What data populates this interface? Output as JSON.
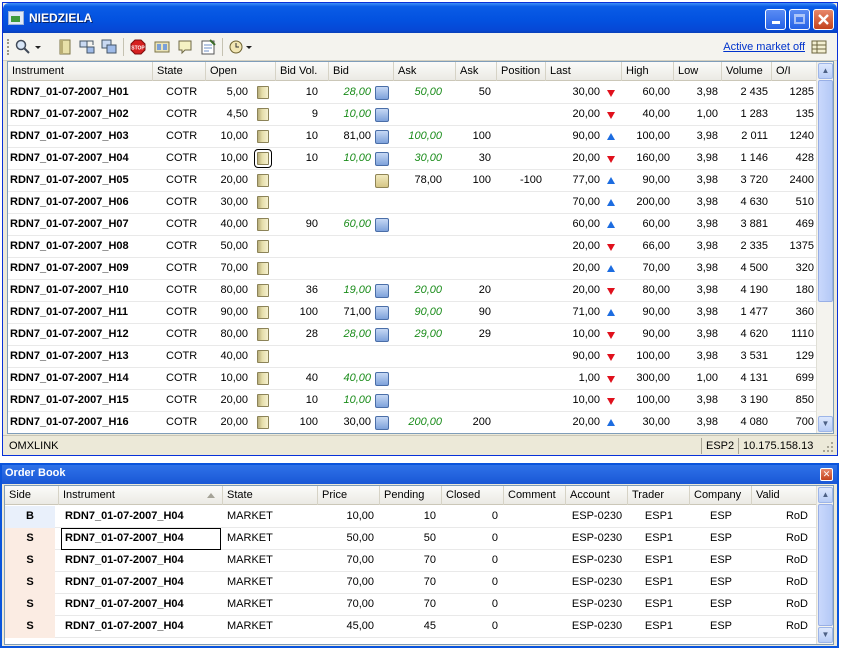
{
  "window": {
    "title": "NIEDZIELA",
    "active_market_link": "Active market off"
  },
  "columns": [
    "Instrument",
    "State",
    "Open",
    "Bid Vol.",
    "Bid",
    "Ask",
    "Ask",
    "Position",
    "Last",
    "High",
    "Low",
    "Volume",
    "O/I"
  ],
  "rows": [
    {
      "instrument": "RDN7_01-07-2007_H01",
      "state": "COTR",
      "open": "5,00",
      "bidvol": "10",
      "bid": "28,00",
      "bid_green": true,
      "bid_icon": "blue",
      "ask": "50,00",
      "askvol": "50",
      "position": "",
      "last": "30,00",
      "dir": "down",
      "high": "60,00",
      "low": "3,98",
      "volume": "2 435",
      "oi": "1285"
    },
    {
      "instrument": "RDN7_01-07-2007_H02",
      "state": "COTR",
      "open": "4,50",
      "bidvol": "9",
      "bid": "10,00",
      "bid_green": true,
      "bid_icon": "blue",
      "ask": "",
      "askvol": "",
      "position": "",
      "last": "20,00",
      "dir": "down",
      "high": "40,00",
      "low": "1,00",
      "volume": "1 283",
      "oi": "135"
    },
    {
      "instrument": "RDN7_01-07-2007_H03",
      "state": "COTR",
      "open": "10,00",
      "bidvol": "10",
      "bid": "81,00",
      "bid_green": false,
      "bid_icon": "blue",
      "ask": "100,00",
      "askvol": "100",
      "position": "",
      "last": "90,00",
      "dir": "up",
      "high": "100,00",
      "low": "3,98",
      "volume": "2 011",
      "oi": "1240"
    },
    {
      "instrument": "RDN7_01-07-2007_H04",
      "state": "COTR",
      "open": "10,00",
      "bidvol": "10",
      "bid": "10,00",
      "bid_green": true,
      "bid_icon": "blue",
      "ask": "30,00",
      "askvol": "30",
      "position": "",
      "last": "20,00",
      "dir": "down",
      "high": "160,00",
      "low": "3,98",
      "volume": "1 146",
      "oi": "428",
      "boxed": true
    },
    {
      "instrument": "RDN7_01-07-2007_H05",
      "state": "COTR",
      "open": "20,00",
      "bidvol": "",
      "bid": "",
      "bid_green": false,
      "bid_icon": "tan",
      "ask": "78,00",
      "ask_plain": true,
      "askvol": "100",
      "position": "-100",
      "last": "77,00",
      "dir": "up",
      "high": "90,00",
      "low": "3,98",
      "volume": "3 720",
      "oi": "2400"
    },
    {
      "instrument": "RDN7_01-07-2007_H06",
      "state": "COTR",
      "open": "30,00",
      "bidvol": "",
      "bid": "",
      "bid_green": false,
      "bid_icon": "",
      "ask": "",
      "askvol": "",
      "position": "",
      "last": "70,00",
      "dir": "up",
      "high": "200,00",
      "low": "3,98",
      "volume": "4 630",
      "oi": "510"
    },
    {
      "instrument": "RDN7_01-07-2007_H07",
      "state": "COTR",
      "open": "40,00",
      "bidvol": "90",
      "bid": "60,00",
      "bid_green": true,
      "bid_icon": "blue",
      "ask": "",
      "askvol": "",
      "position": "",
      "last": "60,00",
      "dir": "up",
      "high": "60,00",
      "low": "3,98",
      "volume": "3 881",
      "oi": "469"
    },
    {
      "instrument": "RDN7_01-07-2007_H08",
      "state": "COTR",
      "open": "50,00",
      "bidvol": "",
      "bid": "",
      "bid_green": false,
      "bid_icon": "",
      "ask": "",
      "askvol": "",
      "position": "",
      "last": "20,00",
      "dir": "down",
      "high": "66,00",
      "low": "3,98",
      "volume": "2 335",
      "oi": "1375"
    },
    {
      "instrument": "RDN7_01-07-2007_H09",
      "state": "COTR",
      "open": "70,00",
      "bidvol": "",
      "bid": "",
      "bid_green": false,
      "bid_icon": "",
      "ask": "",
      "askvol": "",
      "position": "",
      "last": "20,00",
      "dir": "up",
      "high": "70,00",
      "low": "3,98",
      "volume": "4 500",
      "oi": "320"
    },
    {
      "instrument": "RDN7_01-07-2007_H10",
      "state": "COTR",
      "open": "80,00",
      "bidvol": "36",
      "bid": "19,00",
      "bid_green": true,
      "bid_icon": "blue",
      "ask": "20,00",
      "askvol": "20",
      "position": "",
      "last": "20,00",
      "dir": "down",
      "high": "80,00",
      "low": "3,98",
      "volume": "4 190",
      "oi": "180"
    },
    {
      "instrument": "RDN7_01-07-2007_H11",
      "state": "COTR",
      "open": "90,00",
      "bidvol": "100",
      "bid": "71,00",
      "bid_green": false,
      "bid_icon": "blue",
      "ask": "90,00",
      "askvol": "90",
      "position": "",
      "last": "71,00",
      "dir": "up",
      "high": "90,00",
      "low": "3,98",
      "volume": "1 477",
      "oi": "360"
    },
    {
      "instrument": "RDN7_01-07-2007_H12",
      "state": "COTR",
      "open": "80,00",
      "bidvol": "28",
      "bid": "28,00",
      "bid_green": true,
      "bid_icon": "blue",
      "ask": "29,00",
      "askvol": "29",
      "position": "",
      "last": "10,00",
      "dir": "down",
      "high": "90,00",
      "low": "3,98",
      "volume": "4 620",
      "oi": "1110"
    },
    {
      "instrument": "RDN7_01-07-2007_H13",
      "state": "COTR",
      "open": "40,00",
      "bidvol": "",
      "bid": "",
      "bid_green": false,
      "bid_icon": "",
      "ask": "",
      "askvol": "",
      "position": "",
      "last": "90,00",
      "dir": "down",
      "high": "100,00",
      "low": "3,98",
      "volume": "3 531",
      "oi": "129"
    },
    {
      "instrument": "RDN7_01-07-2007_H14",
      "state": "COTR",
      "open": "10,00",
      "bidvol": "40",
      "bid": "40,00",
      "bid_green": true,
      "bid_icon": "blue",
      "ask": "",
      "askvol": "",
      "position": "",
      "last": "1,00",
      "dir": "down",
      "high": "300,00",
      "low": "1,00",
      "volume": "4 131",
      "oi": "699"
    },
    {
      "instrument": "RDN7_01-07-2007_H15",
      "state": "COTR",
      "open": "20,00",
      "bidvol": "10",
      "bid": "10,00",
      "bid_green": true,
      "bid_icon": "blue",
      "ask": "",
      "askvol": "",
      "position": "",
      "last": "10,00",
      "dir": "down",
      "high": "100,00",
      "low": "3,98",
      "volume": "3 190",
      "oi": "850"
    },
    {
      "instrument": "RDN7_01-07-2007_H16",
      "state": "COTR",
      "open": "20,00",
      "bidvol": "100",
      "bid": "30,00",
      "bid_green": false,
      "bid_icon": "blue",
      "ask": "200,00",
      "askvol": "200",
      "position": "",
      "last": "20,00",
      "dir": "up",
      "high": "30,00",
      "low": "3,98",
      "volume": "4 080",
      "oi": "700"
    }
  ],
  "status": {
    "left": "OMXLINK",
    "right1": "ESP2",
    "right2": "10.175.158.13"
  },
  "order_book": {
    "title": "Order Book",
    "columns": [
      "Side",
      "Instrument",
      "State",
      "Price",
      "Pending",
      "Closed",
      "Comment",
      "Account",
      "Trader",
      "Company",
      "Valid"
    ],
    "rows": [
      {
        "side": "B",
        "instrument": "RDN7_01-07-2007_H04",
        "state": "MARKET",
        "price": "10,00",
        "pending": "10",
        "closed": "0",
        "comment": "",
        "account": "ESP-0230",
        "trader": "ESP1",
        "company": "ESP",
        "valid": "RoD"
      },
      {
        "side": "S",
        "instrument": "RDN7_01-07-2007_H04",
        "state": "MARKET",
        "price": "50,00",
        "pending": "50",
        "closed": "0",
        "comment": "",
        "account": "ESP-0230",
        "trader": "ESP1",
        "company": "ESP",
        "valid": "RoD",
        "boxed": true
      },
      {
        "side": "S",
        "instrument": "RDN7_01-07-2007_H04",
        "state": "MARKET",
        "price": "70,00",
        "pending": "70",
        "closed": "0",
        "comment": "",
        "account": "ESP-0230",
        "trader": "ESP1",
        "company": "ESP",
        "valid": "RoD"
      },
      {
        "side": "S",
        "instrument": "RDN7_01-07-2007_H04",
        "state": "MARKET",
        "price": "70,00",
        "pending": "70",
        "closed": "0",
        "comment": "",
        "account": "ESP-0230",
        "trader": "ESP1",
        "company": "ESP",
        "valid": "RoD"
      },
      {
        "side": "S",
        "instrument": "RDN7_01-07-2007_H04",
        "state": "MARKET",
        "price": "70,00",
        "pending": "70",
        "closed": "0",
        "comment": "",
        "account": "ESP-0230",
        "trader": "ESP1",
        "company": "ESP",
        "valid": "RoD"
      },
      {
        "side": "S",
        "instrument": "RDN7_01-07-2007_H04",
        "state": "MARKET",
        "price": "45,00",
        "pending": "45",
        "closed": "0",
        "comment": "",
        "account": "ESP-0230",
        "trader": "ESP1",
        "company": "ESP",
        "valid": "RoD"
      }
    ]
  },
  "colors": {
    "green_bid": "#1a8c1a",
    "arrow_down": "#e0101c",
    "arrow_up": "#1c6ce0",
    "titlebar": "#0352e0"
  },
  "icons": [
    "find-icon",
    "book-icon",
    "edit-grid-icon",
    "copy-grid-icon",
    "stop-icon",
    "layout-icon",
    "comment-icon",
    "notepad-icon",
    "clock-icon",
    "grid-view-icon"
  ]
}
